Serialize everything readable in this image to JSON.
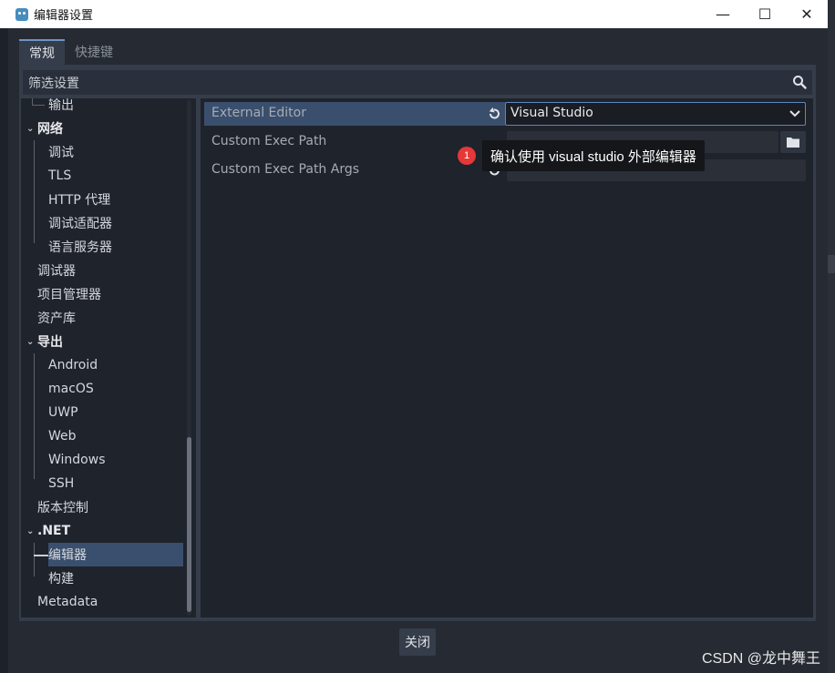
{
  "window": {
    "title": "编辑器设置",
    "minimize": "—",
    "maximize": "☐",
    "close": "✕"
  },
  "tabs": [
    {
      "label": "常规"
    },
    {
      "label": "快捷键"
    }
  ],
  "filter": {
    "placeholder": "筛选设置"
  },
  "sidebar": {
    "items": [
      {
        "label": "输出"
      },
      {
        "label": "网络"
      },
      {
        "label": "调试"
      },
      {
        "label": "TLS"
      },
      {
        "label": "HTTP 代理"
      },
      {
        "label": "调试适配器"
      },
      {
        "label": "语言服务器"
      },
      {
        "label": "调试器"
      },
      {
        "label": "项目管理器"
      },
      {
        "label": "资产库"
      },
      {
        "label": "导出"
      },
      {
        "label": "Android"
      },
      {
        "label": "macOS"
      },
      {
        "label": "UWP"
      },
      {
        "label": "Web"
      },
      {
        "label": "Windows"
      },
      {
        "label": "SSH"
      },
      {
        "label": "版本控制"
      },
      {
        "label": ".NET"
      },
      {
        "label": "编辑器"
      },
      {
        "label": "构建"
      },
      {
        "label": "Metadata"
      }
    ],
    "selected": "编辑器"
  },
  "properties": [
    {
      "name": "External Editor",
      "value": "Visual Studio"
    },
    {
      "name": "Custom Exec Path",
      "value": ""
    },
    {
      "name": "Custom Exec Path Args",
      "value": ""
    }
  ],
  "annotation": {
    "number": "1",
    "text": "确认使用 visual studio 外部编辑器"
  },
  "footer": {
    "close_label": "关闭"
  },
  "watermark": "CSDN @龙中舞王",
  "colors": {
    "accent": "#5b88c0",
    "selection": "#3a4f6d",
    "badge": "#e53838"
  }
}
